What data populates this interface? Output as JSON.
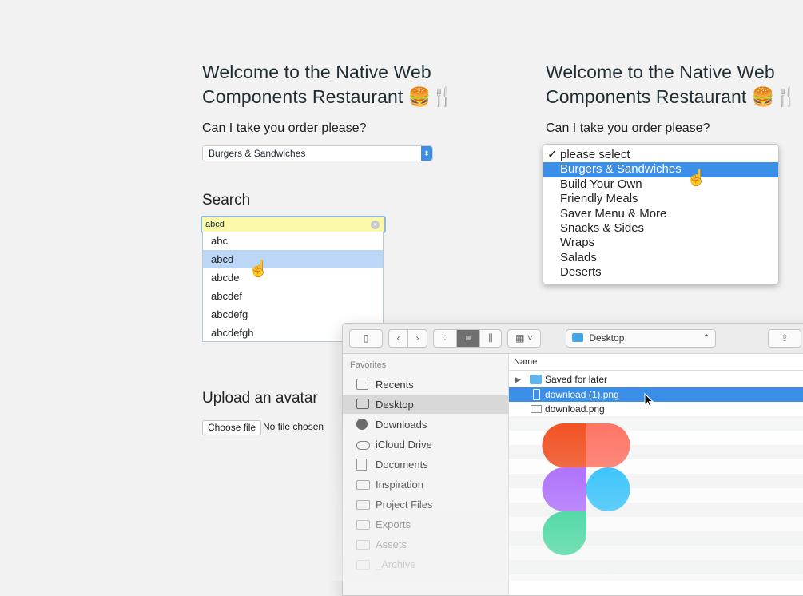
{
  "left": {
    "title_line1": "Welcome to the Native Web",
    "title_line2": "Components Restaurant 🍔🍴",
    "order_prompt": "Can I take you order please?",
    "select_value": "Burgers & Sandwiches",
    "search_heading": "Search",
    "search_value": "abcd",
    "suggestions": [
      "abc",
      "abcd",
      "abcde",
      "abcdef",
      "abcdefg",
      "abcdefgh"
    ],
    "suggestion_highlighted": "abcd",
    "upload_heading": "Upload an avatar",
    "choose_file_label": "Choose file",
    "no_file_text": "No file chosen"
  },
  "right": {
    "title_line1": "Welcome to the Native Web",
    "title_line2": "Components Restaurant 🍔🍴",
    "order_prompt": "Can I take you order please?",
    "options": [
      "please select",
      "Burgers & Sandwiches",
      "Build Your Own",
      "Friendly Meals",
      "Saver Menu & More",
      "Snacks & Sides",
      "Wraps",
      "Salads",
      "Deserts"
    ],
    "checked_option": "please select",
    "highlighted_option": "Burgers & Sandwiches"
  },
  "finder": {
    "location": "Desktop",
    "sidebar_heading": "Favorites",
    "sidebar_items": [
      "Recents",
      "Desktop",
      "Downloads",
      "iCloud Drive",
      "Documents",
      "Inspiration",
      "Project Files",
      "Exports",
      "Assets",
      "_Archive"
    ],
    "selected_sidebar_item": "Desktop",
    "column_name": "Name",
    "files": [
      "Saved for later",
      "download (1).png",
      "download.png"
    ],
    "selected_file": "download (1).png"
  },
  "colors": {
    "accent_blue": "#3c8fe9",
    "search_highlight": "#fbf9a9",
    "suggestion_highlight": "#bcd6f7"
  },
  "logo": {
    "name": "figma-logo",
    "colors": [
      "#f24e1e",
      "#ff7262",
      "#a259ff",
      "#1abcfe",
      "#0acf83"
    ]
  }
}
